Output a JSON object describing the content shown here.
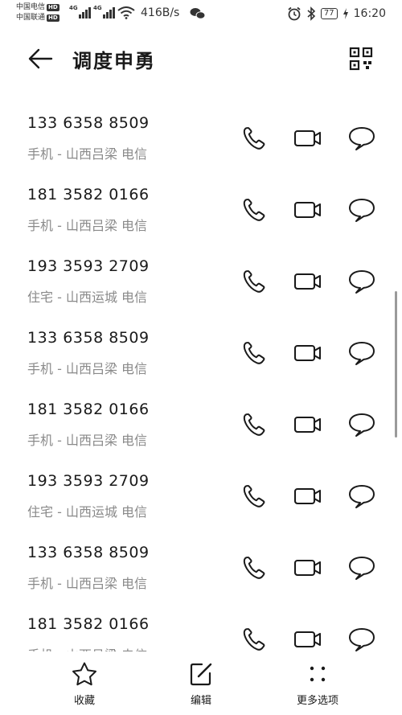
{
  "status_bar": {
    "carrier1": "中国电信",
    "carrier2": "中国联通",
    "hd_badge": "HD",
    "signal_tag": "4G",
    "net_speed": "416B/s",
    "battery": "77",
    "time": "16:20"
  },
  "header": {
    "title": "调度申勇",
    "back_icon": "arrow-left-icon",
    "qr_icon": "qr-code-icon"
  },
  "contacts": [
    {
      "number": "133 6358 8509",
      "desc": "手机 - 山西吕梁  电信"
    },
    {
      "number": "181 3582 0166",
      "desc": "手机 - 山西吕梁  电信"
    },
    {
      "number": "193 3593 2709",
      "desc": "住宅 - 山西运城  电信"
    },
    {
      "number": "133 6358 8509",
      "desc": "手机 - 山西吕梁  电信"
    },
    {
      "number": "181 3582 0166",
      "desc": "手机 - 山西吕梁  电信"
    },
    {
      "number": "193 3593 2709",
      "desc": "住宅 - 山西运城  电信"
    },
    {
      "number": "133 6358 8509",
      "desc": "手机 - 山西吕梁  电信"
    },
    {
      "number": "181 3582 0166",
      "desc": "手机 - 山西吕梁  电信"
    }
  ],
  "toolbar": {
    "favorite_label": "收藏",
    "edit_label": "编辑",
    "more_label": "更多选项"
  },
  "colors": {
    "text_primary": "#1a1a1a",
    "text_secondary": "#8a8a8a",
    "background": "#ffffff"
  }
}
